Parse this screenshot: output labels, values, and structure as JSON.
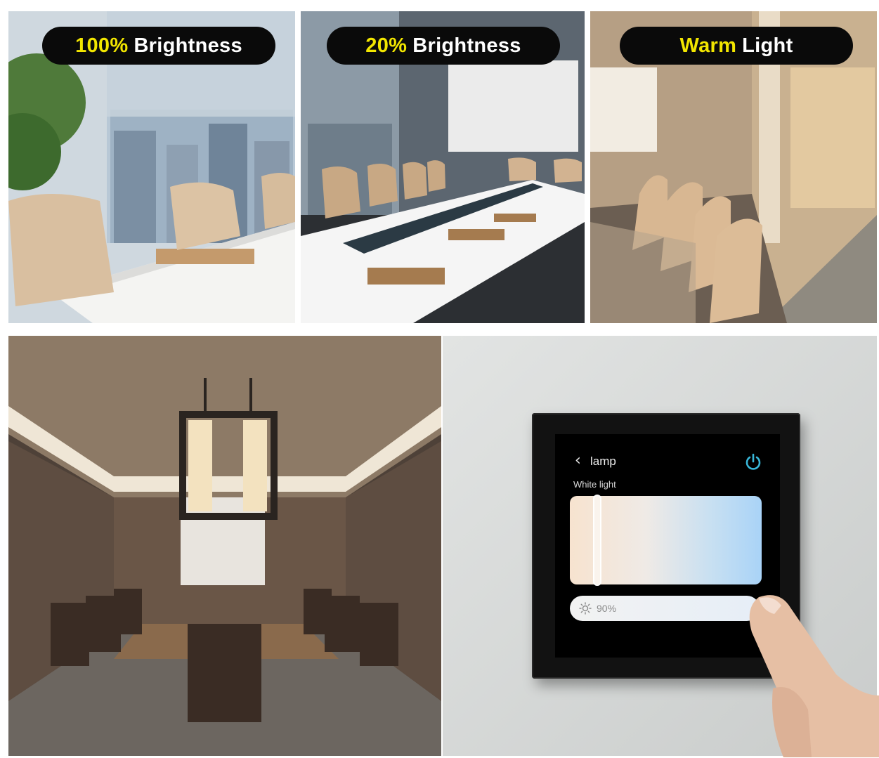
{
  "labels": {
    "panel1": {
      "highlight": "100%",
      "rest": "Brightness"
    },
    "panel2": {
      "highlight": "20%",
      "rest": "Brightness"
    },
    "panel3": {
      "highlight": "Warm",
      "rest": "Light"
    }
  },
  "colors": {
    "highlight": "#f2e600",
    "pill_background": "#0a0a0a",
    "power_accent": "#38b6d8"
  },
  "device": {
    "title": "lamp",
    "section_label": "White light",
    "brightness_text": "90%",
    "brightness_level": 0.9,
    "color_temp_position": 0.14,
    "icons": [
      "back-chevron-icon",
      "power-icon",
      "sun-icon"
    ]
  }
}
